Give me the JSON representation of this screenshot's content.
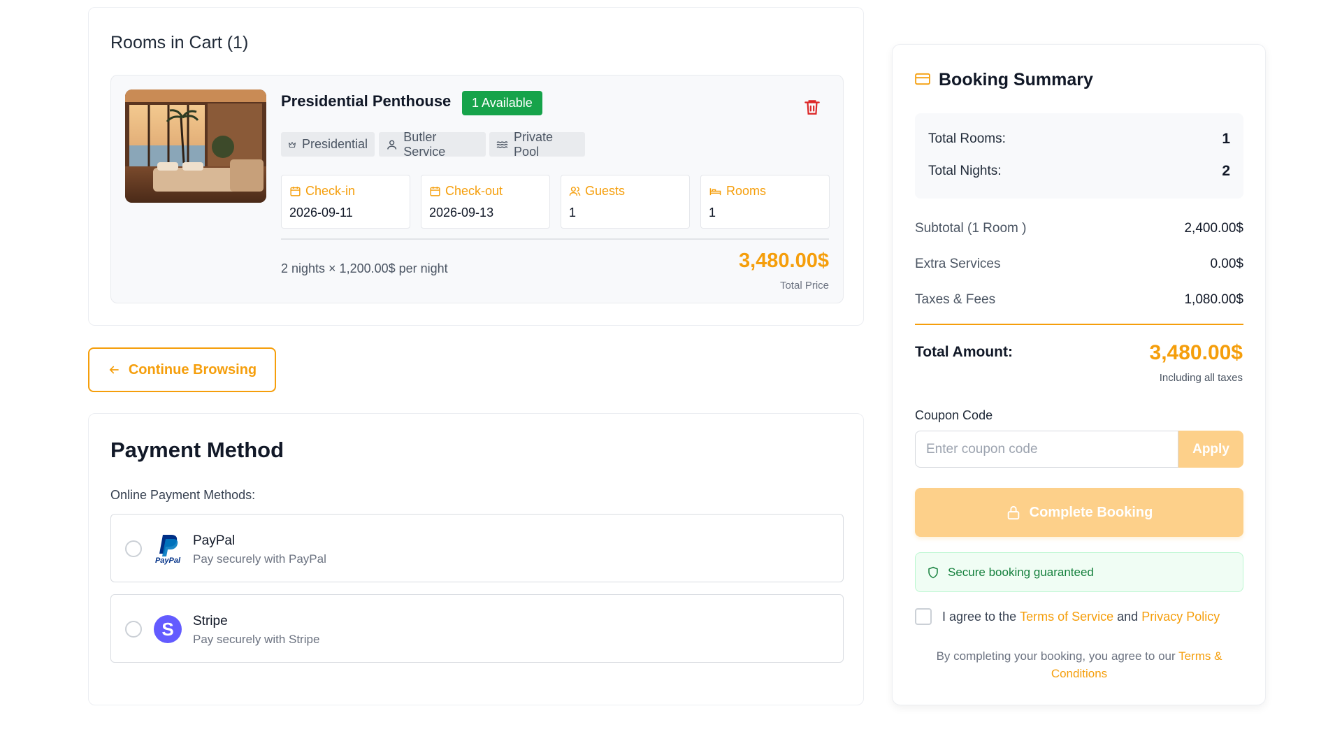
{
  "cart": {
    "title": "Rooms in Cart (1)",
    "room": {
      "name": "Presidential Penthouse",
      "availability": "1 Available",
      "amenities": [
        {
          "icon": "crown-icon",
          "label": "Presidential"
        },
        {
          "icon": "user-icon",
          "label": "Butler Service"
        },
        {
          "icon": "waves-icon",
          "label": "Private Pool"
        }
      ],
      "info": [
        {
          "icon": "calendar-icon",
          "label": "Check-in",
          "value": "2026-09-11"
        },
        {
          "icon": "calendar-icon",
          "label": "Check-out",
          "value": "2026-09-13"
        },
        {
          "icon": "users-icon",
          "label": "Guests",
          "value": "1"
        },
        {
          "icon": "bed-icon",
          "label": "Rooms",
          "value": "1"
        }
      ],
      "nights_text": "2 nights × 1,200.00$ per night",
      "total_price": "3,480.00$",
      "total_price_label": "Total Price"
    }
  },
  "continue_label": "Continue Browsing",
  "payment": {
    "title": "Payment Method",
    "online_label": "Online Payment Methods:",
    "options": [
      {
        "name": "PayPal",
        "desc": "Pay securely with PayPal",
        "logo_text": "PayPal"
      },
      {
        "name": "Stripe",
        "desc": "Pay securely with Stripe",
        "logo_text": "S"
      }
    ]
  },
  "summary": {
    "title": "Booking Summary",
    "total_rooms_label": "Total Rooms:",
    "total_rooms": "1",
    "total_nights_label": "Total Nights:",
    "total_nights": "2",
    "subtotal_label": "Subtotal (1 Room )",
    "subtotal": "2,400.00$",
    "extras_label": "Extra Services",
    "extras": "0.00$",
    "taxes_label": "Taxes & Fees",
    "taxes": "1,080.00$",
    "total_label": "Total Amount:",
    "total": "3,480.00$",
    "total_sub": "Including all taxes",
    "coupon_label": "Coupon Code",
    "coupon_placeholder": "Enter coupon code",
    "apply_label": "Apply",
    "complete_label": "Complete Booking",
    "secure_text": "Secure booking guaranteed",
    "agree_prefix": "I agree to the",
    "terms_link": "Terms of Service",
    "agree_and": "and",
    "privacy_link": "Privacy Policy",
    "note_text": "By completing your booking, you agree to our",
    "note_link": "Terms & Conditions"
  },
  "colors": {
    "accent": "#f59e0b",
    "badge_green": "#16a34a",
    "delete_red": "#dc2626",
    "stripe_purple": "#635bff",
    "paypal_blue": "#003087"
  }
}
